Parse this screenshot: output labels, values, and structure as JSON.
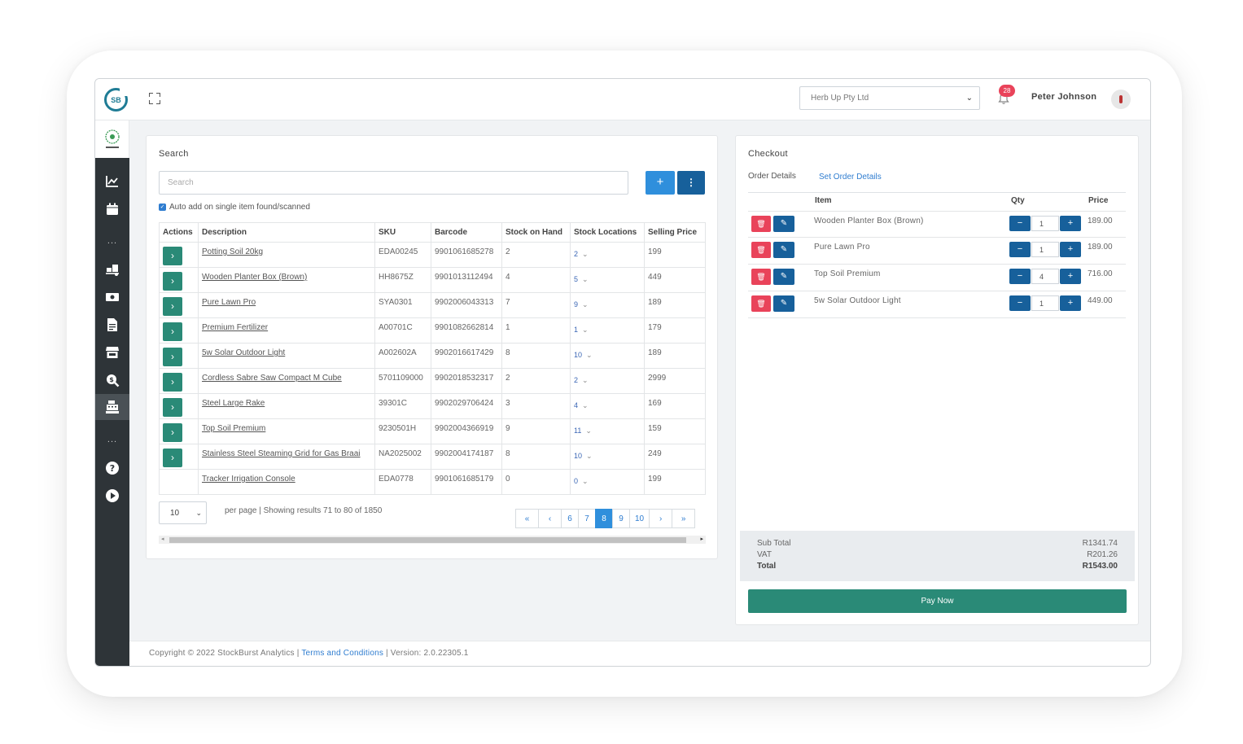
{
  "header": {
    "logo_text": "SB",
    "company_selected": "Herb Up Pty Ltd",
    "notification_count": "28",
    "user_name": "Peter Johnson"
  },
  "sidebar": {
    "brand_icon": "herb-up-logo",
    "icons": [
      "chart-line-icon",
      "calendar-icon",
      "truck-loading-icon",
      "money-bill-icon",
      "file-invoice-icon",
      "store-icon",
      "search-dollar-icon",
      "cash-register-icon",
      "question-circle-icon",
      "play-circle-icon"
    ],
    "separator": "..."
  },
  "search": {
    "title": "Search",
    "placeholder": "Search",
    "add_label": "+",
    "more_label": "⋮",
    "auto_add_label": "Auto add on single item found/scanned",
    "columns": [
      "Actions",
      "Description",
      "SKU",
      "Barcode",
      "Stock on Hand",
      "Stock Locations",
      "Selling Price"
    ],
    "rows": [
      {
        "description": "Potting Soil 20kg",
        "sku": "EDA00245",
        "barcode": "9901061685278",
        "stock": "2",
        "locations": "2",
        "price": "199",
        "has_action": true
      },
      {
        "description": "Wooden Planter Box (Brown)",
        "sku": "HH8675Z",
        "barcode": "9901013112494",
        "stock": "4",
        "locations": "5",
        "price": "449",
        "has_action": true
      },
      {
        "description": "Pure Lawn Pro",
        "sku": "SYA0301",
        "barcode": "9902006043313",
        "stock": "7",
        "locations": "9",
        "price": "189",
        "has_action": true
      },
      {
        "description": "Premium Fertilizer",
        "sku": "A00701C",
        "barcode": "9901082662814",
        "stock": "1",
        "locations": "1",
        "price": "179",
        "has_action": true
      },
      {
        "description": "5w Solar Outdoor Light",
        "sku": "A002602A",
        "barcode": "9902016617429",
        "stock": "8",
        "locations": "10",
        "price": "189",
        "has_action": true
      },
      {
        "description": "Cordless Sabre Saw Compact M Cube",
        "sku": "5701109000",
        "barcode": "9902018532317",
        "stock": "2",
        "locations": "2",
        "price": "2999",
        "has_action": true
      },
      {
        "description": "Steel Large Rake",
        "sku": "39301C",
        "barcode": "9902029706424",
        "stock": "3",
        "locations": "4",
        "price": "169",
        "has_action": true
      },
      {
        "description": "Top Soil Premium",
        "sku": "9230501H",
        "barcode": "9902004366919",
        "stock": "9",
        "locations": "11",
        "price": "159",
        "has_action": true
      },
      {
        "description": "Stainless Steel Steaming Grid for Gas Braai",
        "sku": "NA2025002",
        "barcode": "9902004174187",
        "stock": "8",
        "locations": "10",
        "price": "249",
        "has_action": true
      },
      {
        "description": "Tracker Irrigation Console",
        "sku": "EDA0778",
        "barcode": "9901061685179",
        "stock": "0",
        "locations": "0",
        "price": "199",
        "has_action": false
      }
    ],
    "per_page_value": "10",
    "results_text": "per page | Showing results 71 to 80 of 1850",
    "pages": [
      "6",
      "7",
      "8",
      "9",
      "10"
    ],
    "current_page": "8"
  },
  "checkout": {
    "title": "Checkout",
    "order_details_label": "Order Details",
    "set_order_details_label": "Set Order Details",
    "columns": {
      "item": "Item",
      "qty": "Qty",
      "price": "Price"
    },
    "items": [
      {
        "name": "Wooden Planter Box (Brown)",
        "qty": "1",
        "price": "189.00"
      },
      {
        "name": "Pure Lawn Pro",
        "qty": "1",
        "price": "189.00"
      },
      {
        "name": "Top Soil Premium",
        "qty": "4",
        "price": "716.00"
      },
      {
        "name": "5w Solar Outdoor Light",
        "qty": "1",
        "price": "449.00"
      }
    ],
    "sub_total_label": "Sub Total",
    "sub_total": "R1341.74",
    "vat_label": "VAT",
    "vat": "R201.26",
    "total_label": "Total",
    "total": "R1543.00",
    "pay_label": "Pay Now"
  },
  "footer": {
    "copyright": "Copyright © 2022 StockBurst Analytics |",
    "terms": "Terms and Conditions",
    "version": "| Version: 2.0.22305.1"
  },
  "colors": {
    "sidebar": "#2e3438",
    "primary_blue": "#2f8fdc",
    "dark_blue": "#17609b",
    "green": "#2a8a77",
    "danger": "#e9435a"
  }
}
